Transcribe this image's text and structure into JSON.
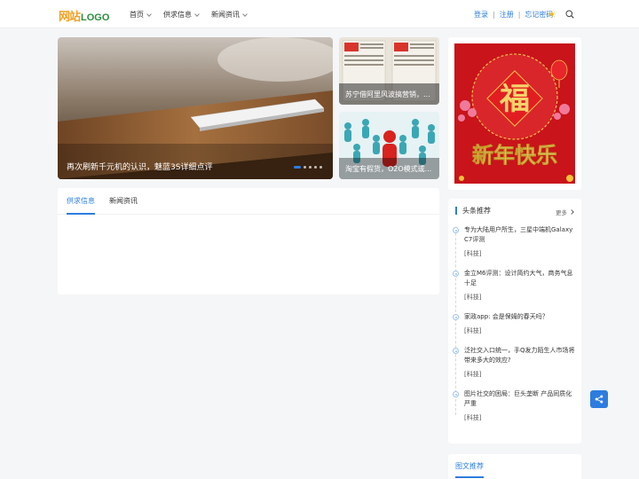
{
  "header": {
    "logo_cn": "网站",
    "logo_en": "LOGO",
    "nav": [
      {
        "label": "首页"
      },
      {
        "label": "供求信息"
      },
      {
        "label": "新闻资讯"
      }
    ],
    "auth": {
      "login": "登录",
      "register": "注册",
      "forgot": "忘记密码",
      "sep": "|"
    }
  },
  "slider": {
    "caption": "再次刷新千元机的认识，魅蓝3S详细点评",
    "thumbs": [
      {
        "caption": "苏宁借阿里风波搞营销，..."
      },
      {
        "caption": "淘宝有假货，O2O模式或..."
      }
    ]
  },
  "tabs": [
    {
      "label": "供求信息"
    },
    {
      "label": "新闻资讯"
    }
  ],
  "sidebar": {
    "banner_text": "新年快乐",
    "banner_fu": "福",
    "hot_title": "头条推荐",
    "more": "更多",
    "items": [
      {
        "title": "专为大陆用户所生，三星中端机Galaxy C7评测",
        "tag": "[科技]"
      },
      {
        "title": "金立M6评测：设计简约大气，商务气息十足",
        "tag": "[科技]"
      },
      {
        "title": "家政app: 会是保姆的春天吗？",
        "tag": "[科技]"
      },
      {
        "title": "泛社交入口统一，手Q发力陌生人市场将带来多大的效应?",
        "tag": "[科技]"
      },
      {
        "title": "图片社交的困局：巨头垄断 产品同质化严重",
        "tag": "[科技]"
      }
    ],
    "img_tab": "图文推荐"
  }
}
